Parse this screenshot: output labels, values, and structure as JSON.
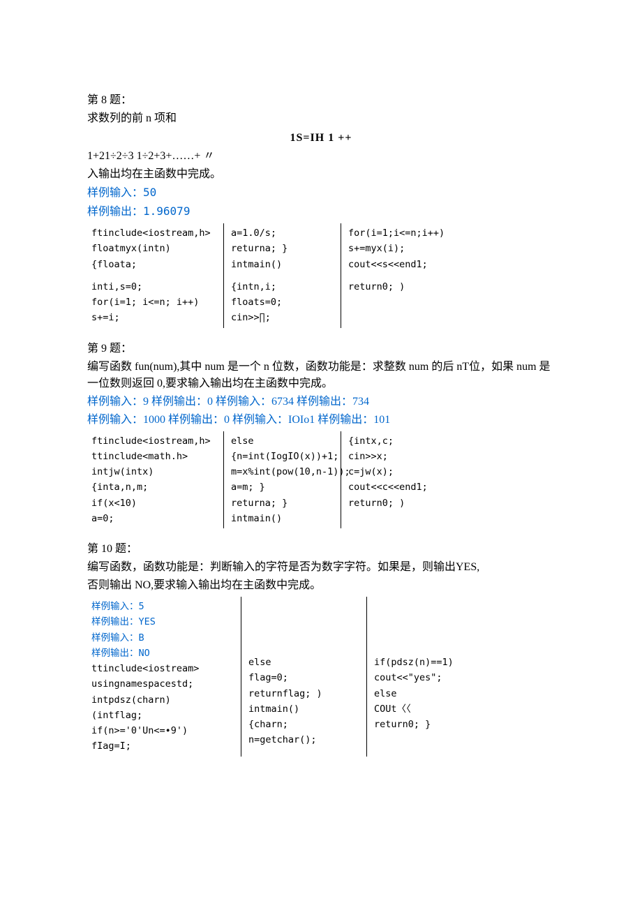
{
  "q8": {
    "heading": "第 8 题：",
    "desc": "求数列的前 n 项和",
    "formula_center": "1S=IH    1       ++",
    "formula_left": "1+21÷2÷3   1÷2+3+……+ 〃",
    "note": "入输出均在主函数中完成。",
    "sample_in_label": "样例输入：",
    "sample_in": "50",
    "sample_out_label": "样例输出：",
    "sample_out": "1.96079",
    "code": {
      "c0": [
        "ftinclude<iostream,h>",
        "floatmyx(intn)",
        "{floata;",
        "",
        "inti,s=0;",
        "for(i=1; i<=n; i++)",
        "s+=i;"
      ],
      "c1": [
        "a=1.0/s;",
        "returna; }",
        "intmain()",
        "",
        "{intn,i;",
        "floats=0;",
        "cin>>∏;"
      ],
      "c2": [
        "for(i=1;i<=n;i++)",
        "s+=myx(i);",
        "cout<<s<<end1;",
        "",
        "return0; )",
        "",
        ""
      ]
    }
  },
  "q9": {
    "heading": "第 9 题：",
    "desc": "编写函数 fun(num),其中 num 是一个 n 位数，函数功能是：求整数 num 的后 nT位，如果 num 是一位数则返回 0,要求输入输出均在主函数中完成。",
    "samples_line1": "样例输入：9 样例输出：0 样例输入：6734 样例输出：734",
    "samples_line2": "样例输入：1000 样例输出：0 样例输入：IOIo1 样例输出：101",
    "code": {
      "c0": [
        "ftinclude<iostream,h>",
        "ttinclude<math.h>",
        "intjw(intx)",
        "{inta,n,m;",
        "if(x<10)",
        "a=0;"
      ],
      "c1": [
        "else",
        "{n=int(IogIO(x))+1;",
        "m=x%int(pow(10,n-1));",
        "a=m; }",
        "returna; }",
        "intmain()"
      ],
      "c2": [
        "{intx,c;",
        "cin>>x;",
        "c=jw(x);",
        "cout<<c<<end1;",
        "return0; )",
        ""
      ]
    }
  },
  "q10": {
    "heading": "第 10 题：",
    "desc1": "编写函数，函数功能是：判断输入的字符是否为数字字符。如果是，则输出YES,",
    "desc2": "否则输出 NO,要求输入输出均在主函数中完成。",
    "samples": [
      "样例输入：5",
      "样例输出：YES",
      "样例输入：B",
      "样例输出：NO"
    ],
    "code": {
      "c0": [
        "ttinclude<iostream>",
        "usingnamespacestd;",
        "intpdsz(charn)",
        "(intflag;",
        "if(n>='0'Un<=∙9')",
        "fIag=I;"
      ],
      "c1": [
        "else",
        "flag=0;",
        "returnflag; )",
        "intmain()",
        "{charn;",
        "n=getchar();"
      ],
      "c2": [
        "if(pdsz(n)==1)",
        "cout<<\"yes\";",
        "else",
        "COUt〈〈",
        "return0; }",
        ""
      ]
    }
  }
}
